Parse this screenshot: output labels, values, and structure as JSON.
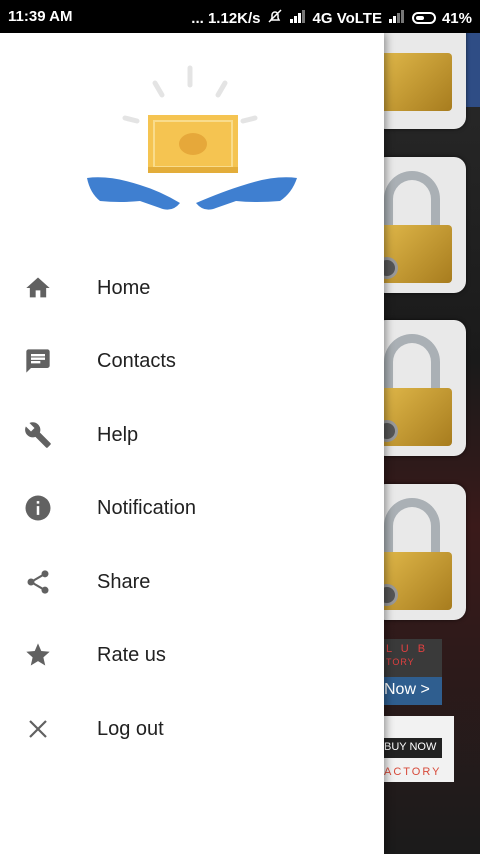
{
  "status_bar": {
    "time": "11:39 AM",
    "speed": "... 1.12K/s",
    "network": "4G VoLTE",
    "battery": "41%"
  },
  "drawer": {
    "menu": [
      {
        "label": "Home",
        "icon": "home-icon"
      },
      {
        "label": "Contacts",
        "icon": "chat-icon"
      },
      {
        "label": "Help",
        "icon": "wrench-icon"
      },
      {
        "label": "Notification",
        "icon": "info-icon"
      },
      {
        "label": "Share",
        "icon": "share-icon"
      },
      {
        "label": "Rate us",
        "icon": "star-icon"
      },
      {
        "label": "Log out",
        "icon": "close-icon"
      }
    ]
  },
  "background_app": {
    "ad1_line1": "L U B",
    "ad1_line2": "TORY",
    "ad1_cta": "Now >",
    "ad2_cta": "BUY NOW",
    "ad2_text": "ACTORY"
  },
  "colors": {
    "appbar": "#2f4d85",
    "icon_gray": "#616161",
    "money_yellow": "#f2c94c",
    "hands_blue": "#3f7fd0"
  }
}
